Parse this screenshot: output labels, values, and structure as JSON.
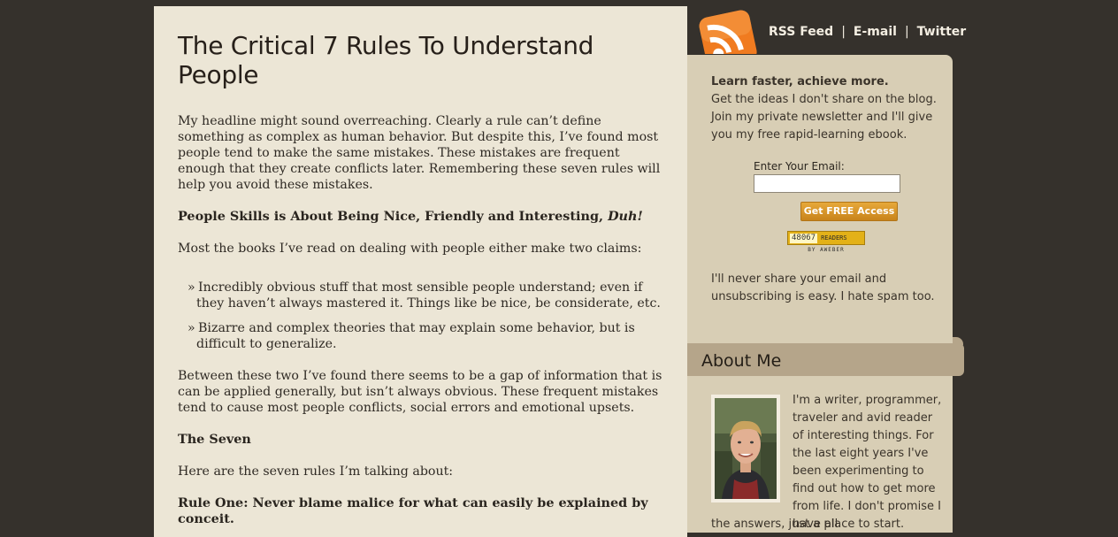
{
  "article": {
    "title": "The Critical 7 Rules To Understand People",
    "intro": "My headline might sound overreaching. Clearly a rule can’t define something as complex as human behavior. But despite this, I’ve found most people tend to make the same mistakes. These mistakes are frequent enough that they create conflicts later. Remembering these seven rules will help you avoid these mistakes.",
    "heading1": "People Skills is About Being Nice, Friendly and Interesting, ",
    "heading1_em": "Duh!",
    "para2": "Most the books I’ve read on dealing with people either make two claims:",
    "bullet_symbol": "»",
    "bullets": [
      "Incredibly obvious stuff that most sensible people understand; even if they haven’t always mastered it. Things like be nice, be considerate, etc.",
      "Bizarre and complex theories that may explain some behavior, but is difficult to generalize."
    ],
    "para3": "Between these two I’ve found there seems to be a gap of information that is can be applied generally, but isn’t always obvious. These frequent mistakes tend to cause most people conflicts, social errors and emotional upsets.",
    "heading2": "The Seven",
    "para4": "Here are the seven rules I’m talking about:",
    "heading3": "Rule One: Never blame malice for what can easily be explained by conceit."
  },
  "topnav": {
    "rss": "RSS Feed",
    "sep": "|",
    "email": "E-mail",
    "twitter": "Twitter"
  },
  "newsletter": {
    "lead": "Learn faster, achieve more.",
    "body": "Get the ideas I don't share on the blog. Join my private newsletter and I'll give you my free rapid-learning ebook.",
    "email_label": "Enter Your Email:",
    "email_value": "",
    "button": "Get FREE Access",
    "readers_count": "48067",
    "readers_label": "READERS",
    "by_label": "BY AWEBER",
    "privacy": "I'll never share your email and unsubscribing is easy. I hate spam too."
  },
  "about": {
    "title": "About Me",
    "text": "I'm a writer, programmer, traveler and avid reader of interesting things. For the last eight years I've been experimenting to find out how to get more from life. I don't promise I have all",
    "text_cont": "the answers, just a place to start."
  },
  "colors": {
    "page_bg": "#35312c",
    "article_bg": "#ece6d6",
    "sidebar_bg": "#d8ceb5",
    "about_header_bg": "#b5a58a",
    "rss_orange": "#f07b20"
  }
}
